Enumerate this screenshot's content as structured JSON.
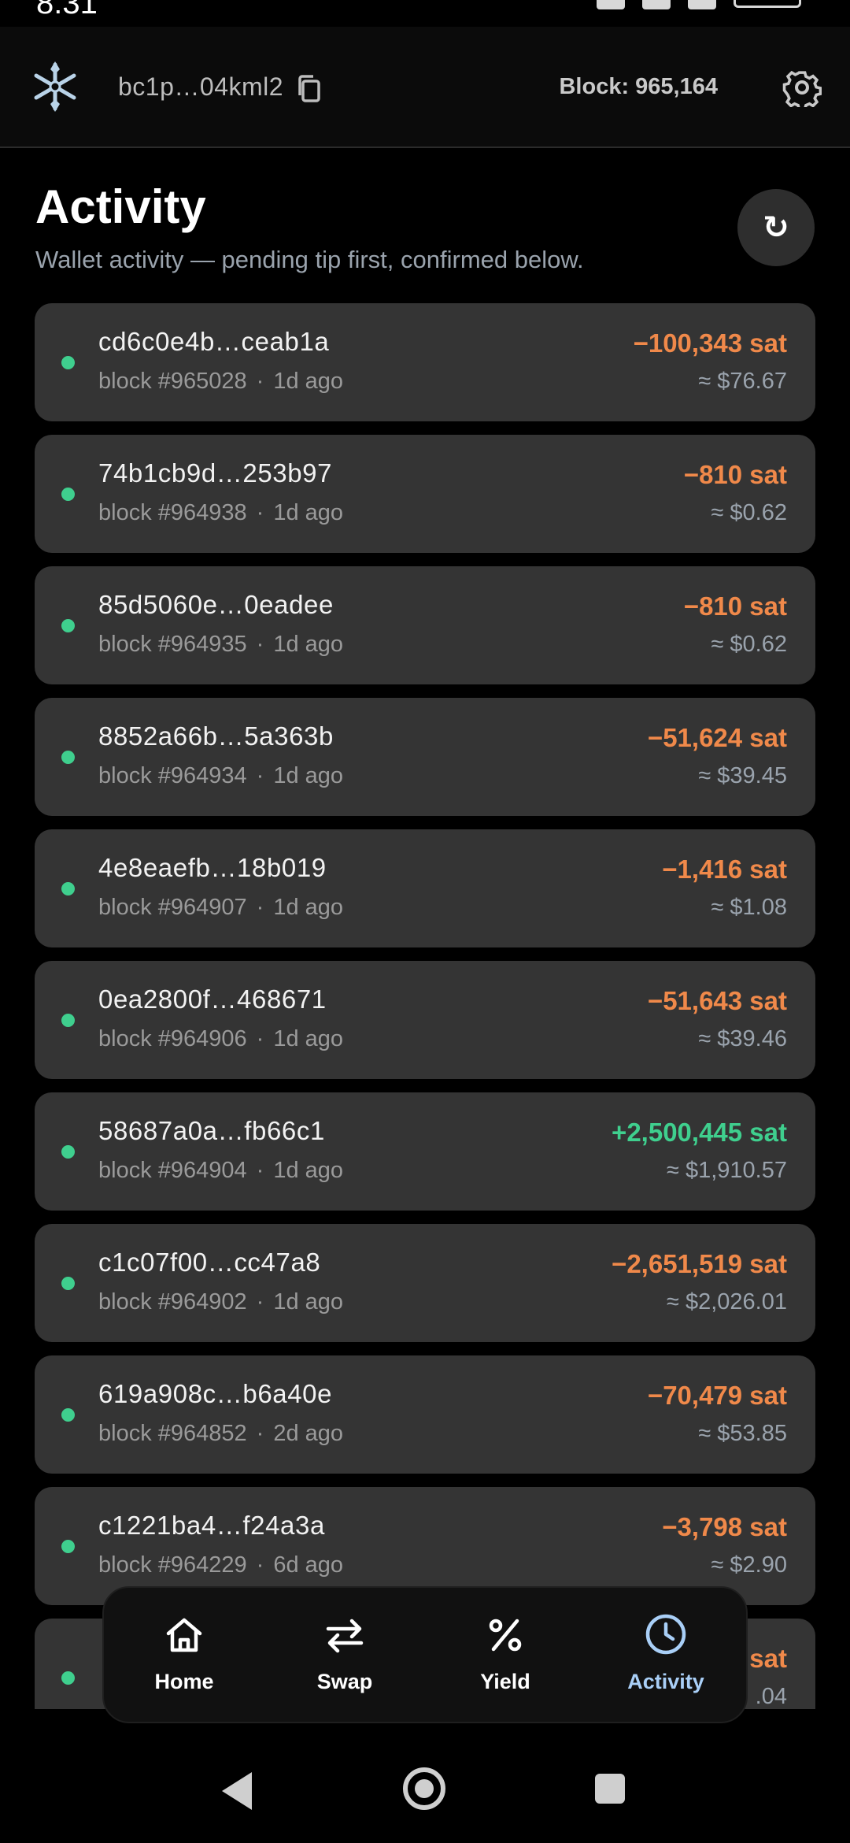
{
  "status_bar": {
    "time": "8:31"
  },
  "header": {
    "address": "bc1p…04kml2",
    "block_label": "Block: 965,164",
    "logo_icon": "snowflake-icon",
    "copy_icon": "copy-icon",
    "settings_icon": "gear-icon"
  },
  "page": {
    "title": "Activity",
    "subtitle": "Wallet activity — pending tip first, confirmed below.",
    "refresh_icon": "↻"
  },
  "colors": {
    "outgoing": "#f0894a",
    "incoming": "#3fcf8e",
    "confirmed_dot": "#3fcf8e",
    "nav_active": "#a9cff7"
  },
  "transactions": [
    {
      "hash": "cd6c0e4b…ceab1a",
      "block": "block #965028",
      "age": "1d ago",
      "amount": "−100,343 sat",
      "fiat": "≈ $76.67",
      "direction": "out"
    },
    {
      "hash": "74b1cb9d…253b97",
      "block": "block #964938",
      "age": "1d ago",
      "amount": "−810 sat",
      "fiat": "≈ $0.62",
      "direction": "out"
    },
    {
      "hash": "85d5060e…0eadee",
      "block": "block #964935",
      "age": "1d ago",
      "amount": "−810 sat",
      "fiat": "≈ $0.62",
      "direction": "out"
    },
    {
      "hash": "8852a66b…5a363b",
      "block": "block #964934",
      "age": "1d ago",
      "amount": "−51,624 sat",
      "fiat": "≈ $39.45",
      "direction": "out"
    },
    {
      "hash": "4e8eaefb…18b019",
      "block": "block #964907",
      "age": "1d ago",
      "amount": "−1,416 sat",
      "fiat": "≈ $1.08",
      "direction": "out"
    },
    {
      "hash": "0ea2800f…468671",
      "block": "block #964906",
      "age": "1d ago",
      "amount": "−51,643 sat",
      "fiat": "≈ $39.46",
      "direction": "out"
    },
    {
      "hash": "58687a0a…fb66c1",
      "block": "block #964904",
      "age": "1d ago",
      "amount": "+2,500,445 sat",
      "fiat": "≈ $1,910.57",
      "direction": "in"
    },
    {
      "hash": "c1c07f00…cc47a8",
      "block": "block #964902",
      "age": "1d ago",
      "amount": "−2,651,519 sat",
      "fiat": "≈ $2,026.01",
      "direction": "out"
    },
    {
      "hash": "619a908c…b6a40e",
      "block": "block #964852",
      "age": "2d ago",
      "amount": "−70,479 sat",
      "fiat": "≈ $53.85",
      "direction": "out"
    },
    {
      "hash": "c1221ba4…f24a3a",
      "block": "block #964229",
      "age": "6d ago",
      "amount": "−3,798 sat",
      "fiat": "≈ $2.90",
      "direction": "out"
    },
    {
      "hash": "",
      "block": "",
      "age": "",
      "amount": "sat",
      "fiat": ".04",
      "direction": "out"
    }
  ],
  "nav": [
    {
      "label": "Home",
      "icon": "home-icon"
    },
    {
      "label": "Swap",
      "icon": "swap-icon"
    },
    {
      "label": "Yield",
      "icon": "percent-icon"
    },
    {
      "label": "Activity",
      "icon": "clock-icon",
      "active": true
    }
  ]
}
